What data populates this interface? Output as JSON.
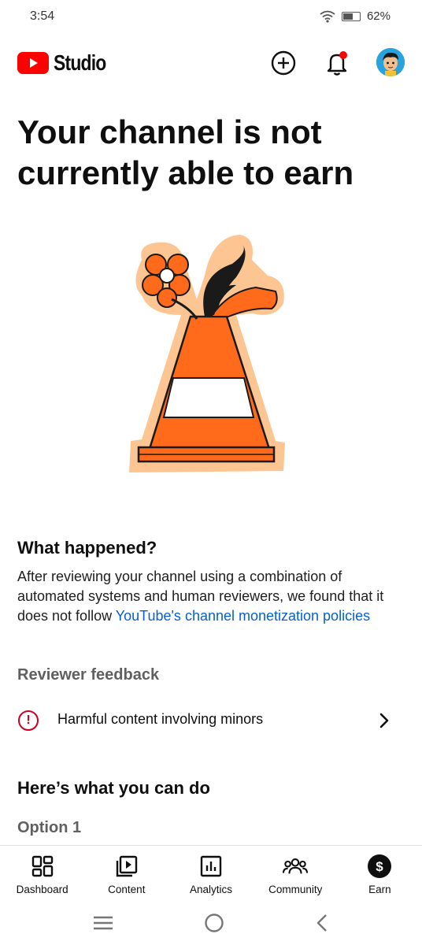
{
  "status_bar": {
    "time": "3:54",
    "battery_percent": "62%",
    "battery_level": 0.62
  },
  "app_bar": {
    "logo_text": "Studio",
    "brand_color": "#ff0000",
    "icons": [
      "create-icon",
      "notifications-icon",
      "avatar"
    ],
    "notification_dot_color": "#ff0000"
  },
  "main": {
    "headline": "Your channel is not currently able to earn",
    "illustration": "traffic-cone-with-flowers",
    "what_happened": {
      "title": "What happened?",
      "body_prefix": "After reviewing your channel using a combination of automated systems and human reviewers, we found that it does not follow ",
      "link_text": "YouTube's channel monetization policies"
    },
    "reviewer_feedback": {
      "title": "Reviewer feedback",
      "items": [
        {
          "icon": "alert-icon",
          "label": "Harmful content involving minors"
        }
      ]
    },
    "what_you_can_do": {
      "title": "Here’s what you can do",
      "option_label": "Option 1"
    }
  },
  "bottom_nav": {
    "items": [
      {
        "label": "Dashboard",
        "icon": "dashboard-icon"
      },
      {
        "label": "Content",
        "icon": "content-icon"
      },
      {
        "label": "Analytics",
        "icon": "analytics-icon"
      },
      {
        "label": "Community",
        "icon": "community-icon"
      },
      {
        "label": "Earn",
        "icon": "earn-icon",
        "selected": true
      }
    ]
  },
  "system_nav": {
    "icons": [
      "recents-icon",
      "home-icon",
      "back-icon"
    ]
  }
}
